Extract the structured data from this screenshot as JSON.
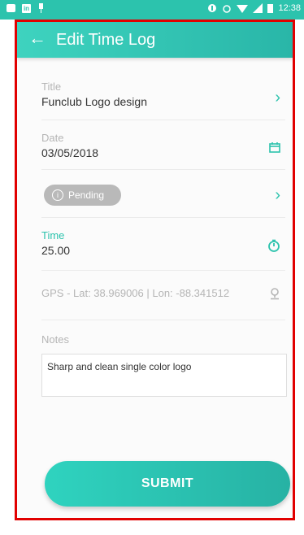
{
  "status_bar": {
    "time": "12:38",
    "left_icons": [
      "message-icon",
      "linkedin-icon",
      "pin-icon"
    ],
    "right_icons": [
      "data-saver-icon",
      "alarm-icon",
      "wifi-icon",
      "signal-icon",
      "battery-icon"
    ]
  },
  "toolbar": {
    "back_icon": "arrow-left-icon",
    "title": "Edit Time Log"
  },
  "form": {
    "title_label": "Title",
    "title_value": "Funclub Logo design",
    "date_label": "Date",
    "date_value": "03/05/2018",
    "status_chip": "Pending",
    "time_label": "Time",
    "time_value": "25.00",
    "gps_text": "GPS -  Lat: 38.969006 | Lon: -88.341512",
    "notes_label": "Notes",
    "notes_value": "Sharp and clean single color logo"
  },
  "actions": {
    "submit_label": "SUBMIT"
  },
  "colors": {
    "accent": "#2cc3ad",
    "highlight_border": "#e10000",
    "chip": "#b9b9b9"
  }
}
